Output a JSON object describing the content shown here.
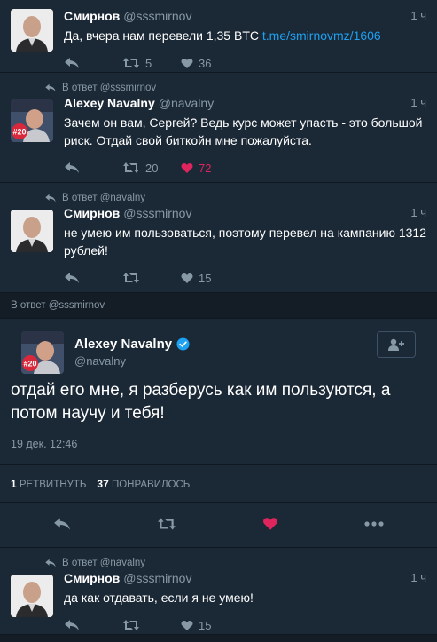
{
  "tweets": [
    {
      "name": "Смирнов",
      "handle": "@sssmirnov",
      "time": "1 ч",
      "text_before": "Да, вчера нам перевели 1,35 BTC ",
      "link": "t.me/smirnovmz/1606",
      "retweets": "5",
      "likes": "36"
    },
    {
      "reply_to": "В ответ @sssmirnov",
      "name": "Alexey Navalny",
      "handle": "@navalny",
      "time": "1 ч",
      "text": "Зачем он вам, Сергей? Ведь курс может упасть - это большой риск. Отдай свой биткойн мне пожалуйста.",
      "retweets": "20",
      "likes": "72"
    },
    {
      "reply_to": "В ответ @navalny",
      "name": "Смирнов",
      "handle": "@sssmirnov",
      "time": "1 ч",
      "text": "не умею им пользоваться, поэтому перевел на кампанию 1312 рублей!",
      "likes": "15"
    }
  ],
  "separator": "В ответ @sssmirnov",
  "main": {
    "name": "Alexey Navalny",
    "handle": "@navalny",
    "text": "отдай его мне, я разберусь как им пользуются, а потом научу и тебя!",
    "date": "19 дек. 12:46",
    "retweets_count": "1",
    "retweets_label": "РЕТВИТНУТЬ",
    "likes_count": "37",
    "likes_label": "ПОНРАВИЛОСЬ"
  },
  "last": {
    "reply_to": "В ответ @navalny",
    "name": "Смирнов",
    "handle": "@sssmirnov",
    "time": "1 ч",
    "text": "да как отдавать, если я не умею!",
    "likes": "15"
  },
  "avatar_badge": "#20",
  "colors": {
    "bg": "#141d26",
    "card": "#1b2836",
    "muted": "#8899a6",
    "link": "#1da1f2",
    "like": "#e0245e"
  }
}
